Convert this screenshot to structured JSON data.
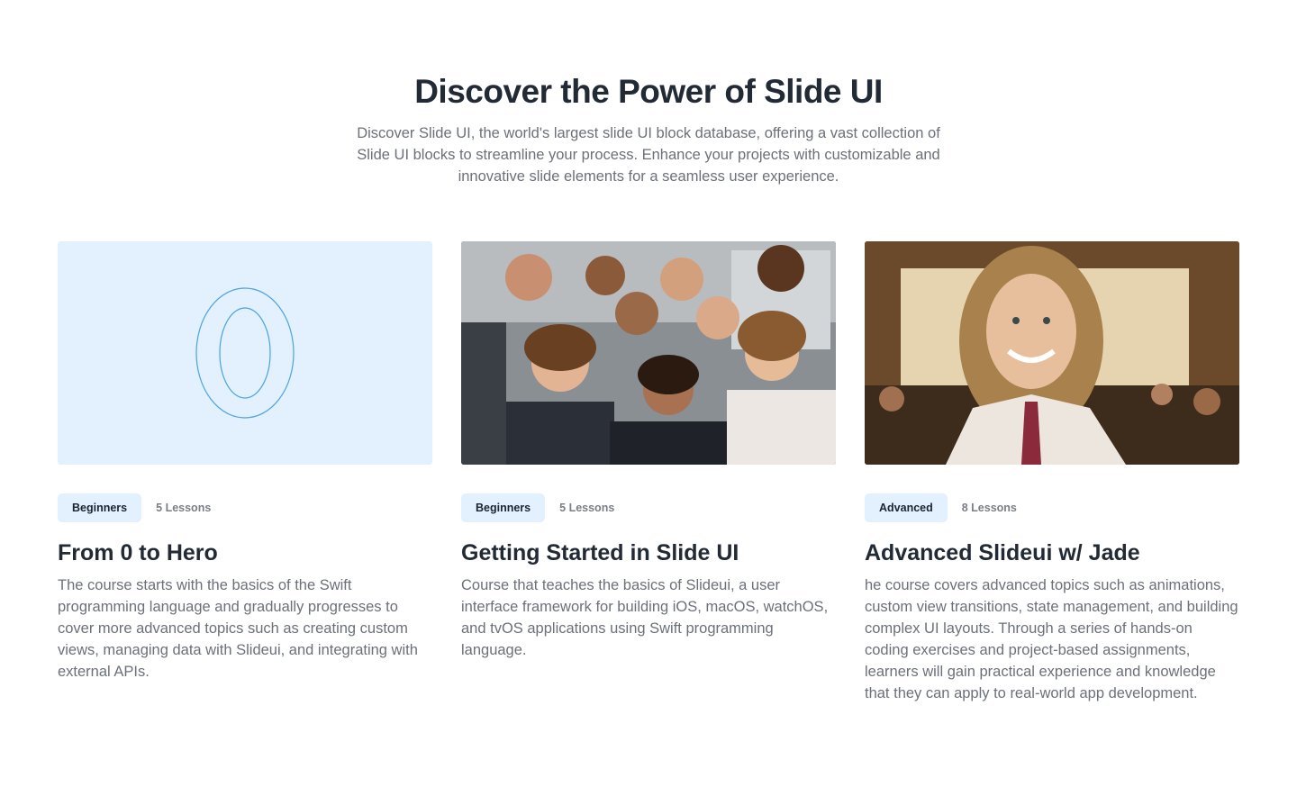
{
  "header": {
    "title": "Discover the Power of Slide UI",
    "subtitle": "Discover Slide UI, the world's largest slide UI block database, offering a vast collection of Slide UI blocks to streamline your process. Enhance your projects with customizable and innovative slide elements for a seamless user experience."
  },
  "colors": {
    "heading": "#222a35",
    "body_text": "#6b7079",
    "badge_bg": "#e2f1fd",
    "outline_accent": "#4aa3e0"
  },
  "cards": [
    {
      "image": "zero-outline-icon",
      "badge": "Beginners",
      "lessons": "5 Lessons",
      "title": "From 0 to Hero",
      "description": "The course starts with the basics of the Swift programming language and gradually progresses to cover more advanced topics such as creating custom views, managing data with Slideui, and integrating with external APIs."
    },
    {
      "image": "team-photo",
      "badge": "Beginners",
      "lessons": "5 Lessons",
      "title": "Getting Started in Slide UI",
      "description": "Course that teaches the basics of Slideui, a user interface framework for building iOS, macOS, watchOS, and tvOS applications using Swift programming language."
    },
    {
      "image": "instructor-photo",
      "badge": "Advanced",
      "lessons": "8 Lessons",
      "title": "Advanced Slideui w/ Jade",
      "description": "he course covers advanced topics such as animations, custom view transitions, state management, and building complex UI layouts. Through a series of hands-on coding exercises and project-based assignments, learners will gain practical experience and knowledge that they can apply to real-world app development."
    }
  ]
}
